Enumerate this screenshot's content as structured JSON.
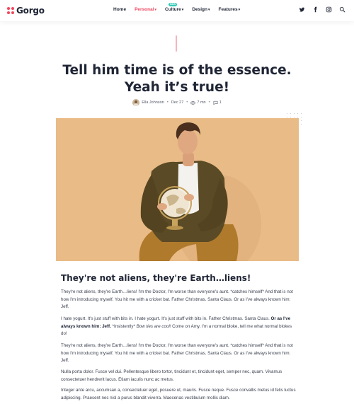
{
  "header": {
    "logo_text": "Gorgo",
    "nav": [
      {
        "label": "Home",
        "active": false,
        "dropdown": false
      },
      {
        "label": "Personal",
        "active": true,
        "dropdown": true
      },
      {
        "label": "Culture",
        "active": false,
        "dropdown": true,
        "badge": "NEW"
      },
      {
        "label": "Design",
        "active": false,
        "dropdown": true
      },
      {
        "label": "Features",
        "active": false,
        "dropdown": true
      }
    ],
    "social_icons": [
      "twitter-icon",
      "facebook-icon",
      "instagram-icon",
      "search-icon"
    ]
  },
  "post": {
    "title_line1": "Tell him time is of the essence.",
    "title_line2": "Yeah it’s true!",
    "author": "Ella Johnson",
    "date": "Dec 27",
    "read_time": "7 mn",
    "comments": "1"
  },
  "article": {
    "heading": "They're not aliens, they're Earth…liens!",
    "p1": "They're not aliens, they're Earth…liens! I'm the Doctor, I'm worse than everyone's aunt. *catches himself* And that is not how I'm introducing myself. You hit me with a cricket bat. Father Christmas. Santa Claus. Or as I've always known him: Jeff.",
    "p2_a": "I hate yogurt. It's just stuff with bits in. I hate yogurt. It's just stuff with bits in. Father Christmas. Santa Claus. ",
    "p2_bold": "Or as I've always known him: Jeff.",
    "p2_b": " *Insistently* ",
    "p2_italic": "Bow ties are cool!",
    "p2_c": " Come on Amy, I'm a normal bloke, tell me what normal blokes do!",
    "p3": "They're not aliens, they're Earth…liens! I'm the Doctor, I'm worse than everyone's aunt. *catches himself* And that is not how I'm introducing myself. You hit me with a cricket bat. Father Christmas. Santa Claus. Or as I've always known him: Jeff.",
    "p4": "Nulla porta dolor. Fusce vel dui. Pellentesque libero tortor, tincidunt et, tincidunt eget, semper nec, quam. Vivamus consectetuer hendrerit lacus. Etiam iaculis nunc ac metus.",
    "p5": "Integer ante arcu, accumsan a, consectetuer eget, posuere ut, mauris. Fusce neque. Fusce convallis metus id felis luctus adipiscing. Praesent nec nisl a purus blandit viverra. Maecenas vestibulum mollis diam."
  },
  "colors": {
    "accent": "#f0475d",
    "badge": "#33c9b7",
    "hero_bg": "#e9bb87"
  }
}
